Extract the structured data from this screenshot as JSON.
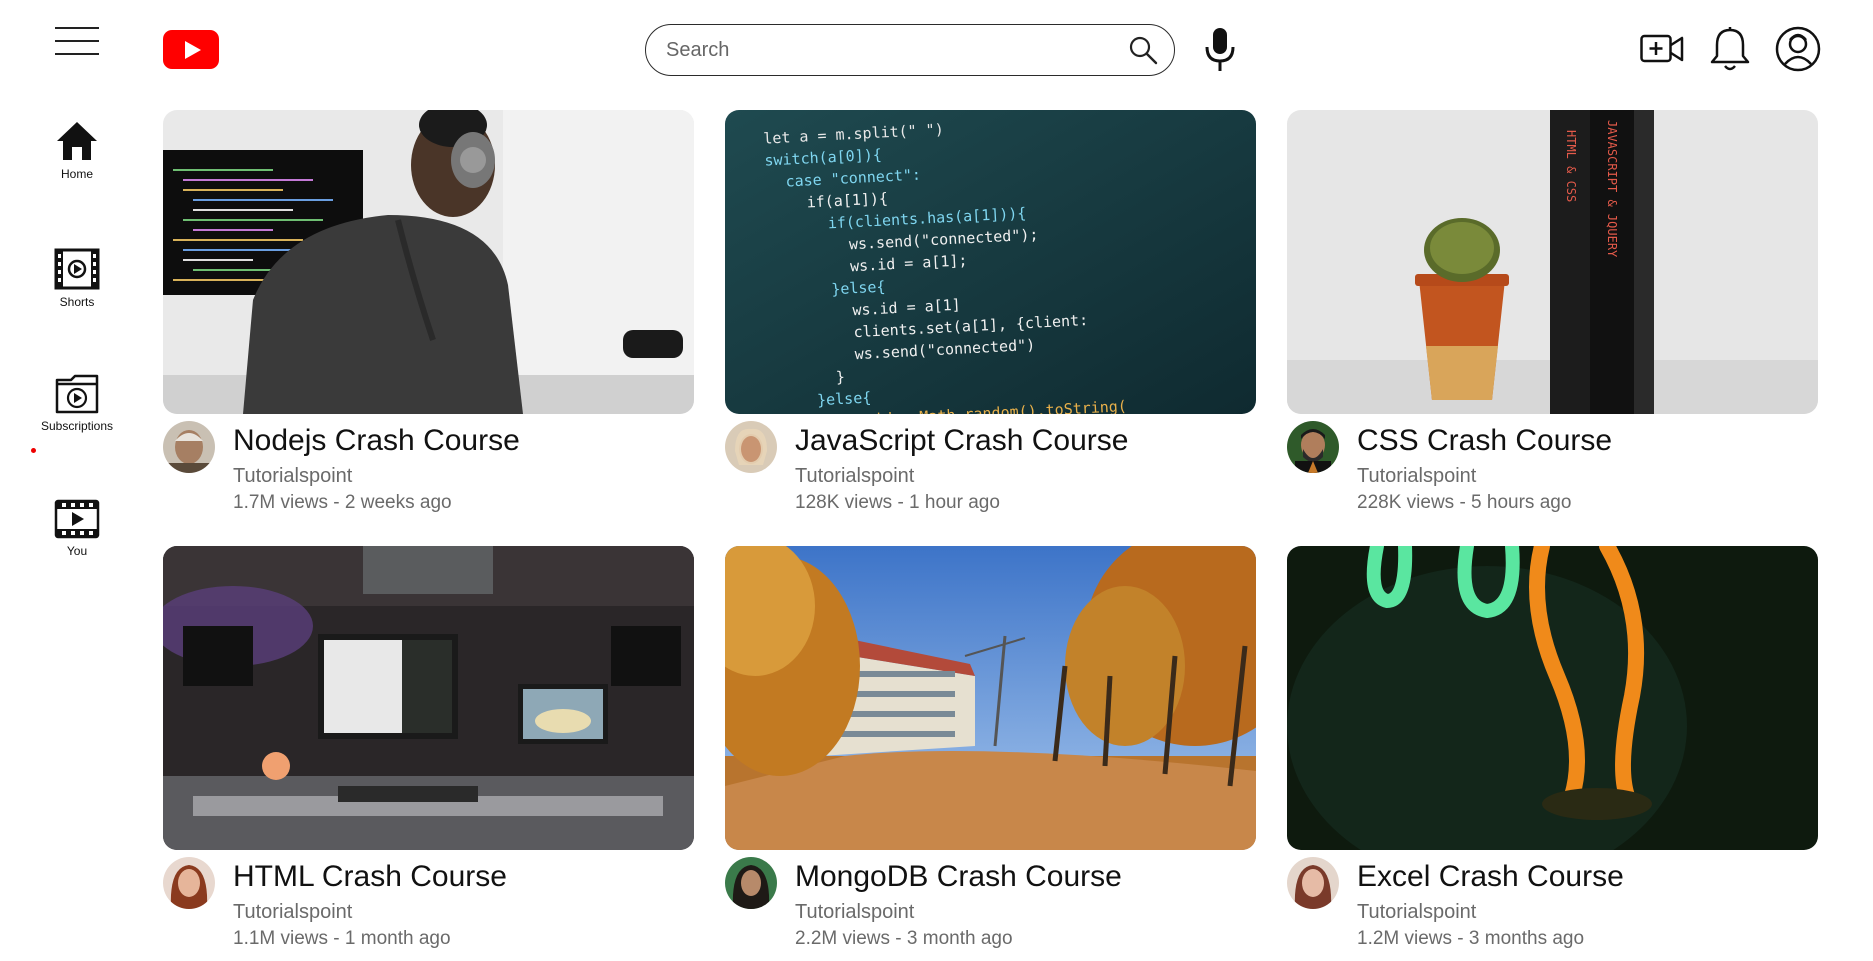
{
  "header": {
    "search": {
      "placeholder": "Search",
      "value": ""
    },
    "icons": [
      "menu-icon",
      "youtube-logo",
      "search-icon",
      "microphone-icon",
      "create-video-icon",
      "notifications-bell-icon",
      "account-avatar-icon"
    ]
  },
  "sidebar": {
    "items": [
      {
        "label": "Home",
        "icon": "home-icon"
      },
      {
        "label": "Shorts",
        "icon": "shorts-icon"
      },
      {
        "label": "Subscriptions",
        "icon": "subscriptions-icon"
      },
      {
        "label": "You",
        "icon": "you-icon"
      }
    ]
  },
  "videos": [
    {
      "title": "Nodejs Crash Course",
      "channel": "Tutorialspoint",
      "stats": "1.7M views - 2 weeks ago"
    },
    {
      "title": "JavaScript Crash Course",
      "channel": "Tutorialspoint",
      "stats": "128K views - 1 hour ago"
    },
    {
      "title": "CSS Crash Course",
      "channel": "Tutorialspoint",
      "stats": "228K views - 5 hours ago"
    },
    {
      "title": "HTML Crash Course",
      "channel": "Tutorialspoint",
      "stats": "1.1M views - 1 month ago"
    },
    {
      "title": "MongoDB Crash Course",
      "channel": "Tutorialspoint",
      "stats": "2.2M views - 3 month ago"
    },
    {
      "title": "Excel Crash Course",
      "channel": "Tutorialspoint",
      "stats": "1.2M views - 3 months ago"
    }
  ],
  "thumbnail_code_lines": [
    "let a = m.split(\" \")",
    "switch(a[0]){",
    "case \"connect\":",
    "if(a[1]){",
    "if(clients.has(a[1])){",
    "ws.send(\"connected\");",
    "ws.id = a[1];",
    "}else{",
    "ws.id = a[1]",
    "clients.set(a[1], {client:",
    "ws.send(\"connected\")",
    "}",
    "}else{",
    "let id = Math.random().toString("
  ],
  "book_spines": [
    "HTML & CSS",
    "JAVASCRIPT & JQUERY"
  ],
  "colors": {
    "brand_red": "#ff0000",
    "text_primary": "#111111",
    "text_secondary": "#6a6a6a"
  }
}
